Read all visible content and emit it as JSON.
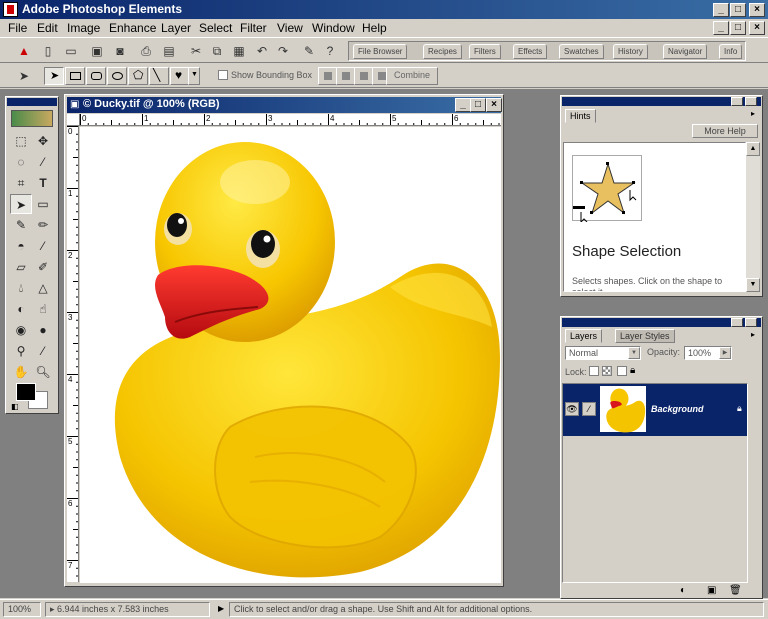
{
  "app": {
    "title": "Adobe Photoshop Elements"
  },
  "window_controls": {
    "minimize": "_",
    "maximize": "□",
    "close": "×"
  },
  "menu": [
    {
      "label": "File"
    },
    {
      "label": "Edit"
    },
    {
      "label": "Image"
    },
    {
      "label": "Enhance"
    },
    {
      "label": "Layer"
    },
    {
      "label": "Select"
    },
    {
      "label": "Filter"
    },
    {
      "label": "View"
    },
    {
      "label": "Window"
    },
    {
      "label": "Help"
    }
  ],
  "palette_well": {
    "tabs": [
      "File Browser",
      "Recipes",
      "Filters",
      "Effects",
      "Swatches",
      "History",
      "Navigator",
      "Info"
    ]
  },
  "options_bar": {
    "show_bounding_box": "Show Bounding Box",
    "combine": "Combine"
  },
  "document": {
    "title": "© Ducky.tif @ 100% (RGB)",
    "ruler_top": [
      "0",
      "1",
      "2",
      "3",
      "4",
      "5",
      "6"
    ],
    "ruler_left": [
      "0",
      "1",
      "2",
      "3",
      "4",
      "5",
      "6",
      "7"
    ]
  },
  "hints": {
    "tabs": [
      "Hints"
    ],
    "more_help": "More Help",
    "heading": "Shape Selection",
    "body": "Selects shapes. Click on the shape to select it."
  },
  "layers": {
    "tabs": [
      "Layers",
      "Layer Styles"
    ],
    "blend_mode": "Normal",
    "opacity_label": "Opacity:",
    "opacity_value": "100%",
    "lock_label": "Lock:",
    "items": [
      {
        "name": "Background"
      }
    ]
  },
  "status": {
    "zoom": "100%",
    "doc_size": "6.944 inches x 7.583 inches",
    "hint": "Click to select and/or drag a shape. Use Shift and Alt for additional options."
  },
  "colors": {
    "title_bar": "#0a246a",
    "chrome": "#d4d0c8",
    "workspace": "#808080",
    "duck_yellow": "#f5c400",
    "beak_red": "#d8141c",
    "selection": "#0a246a"
  }
}
